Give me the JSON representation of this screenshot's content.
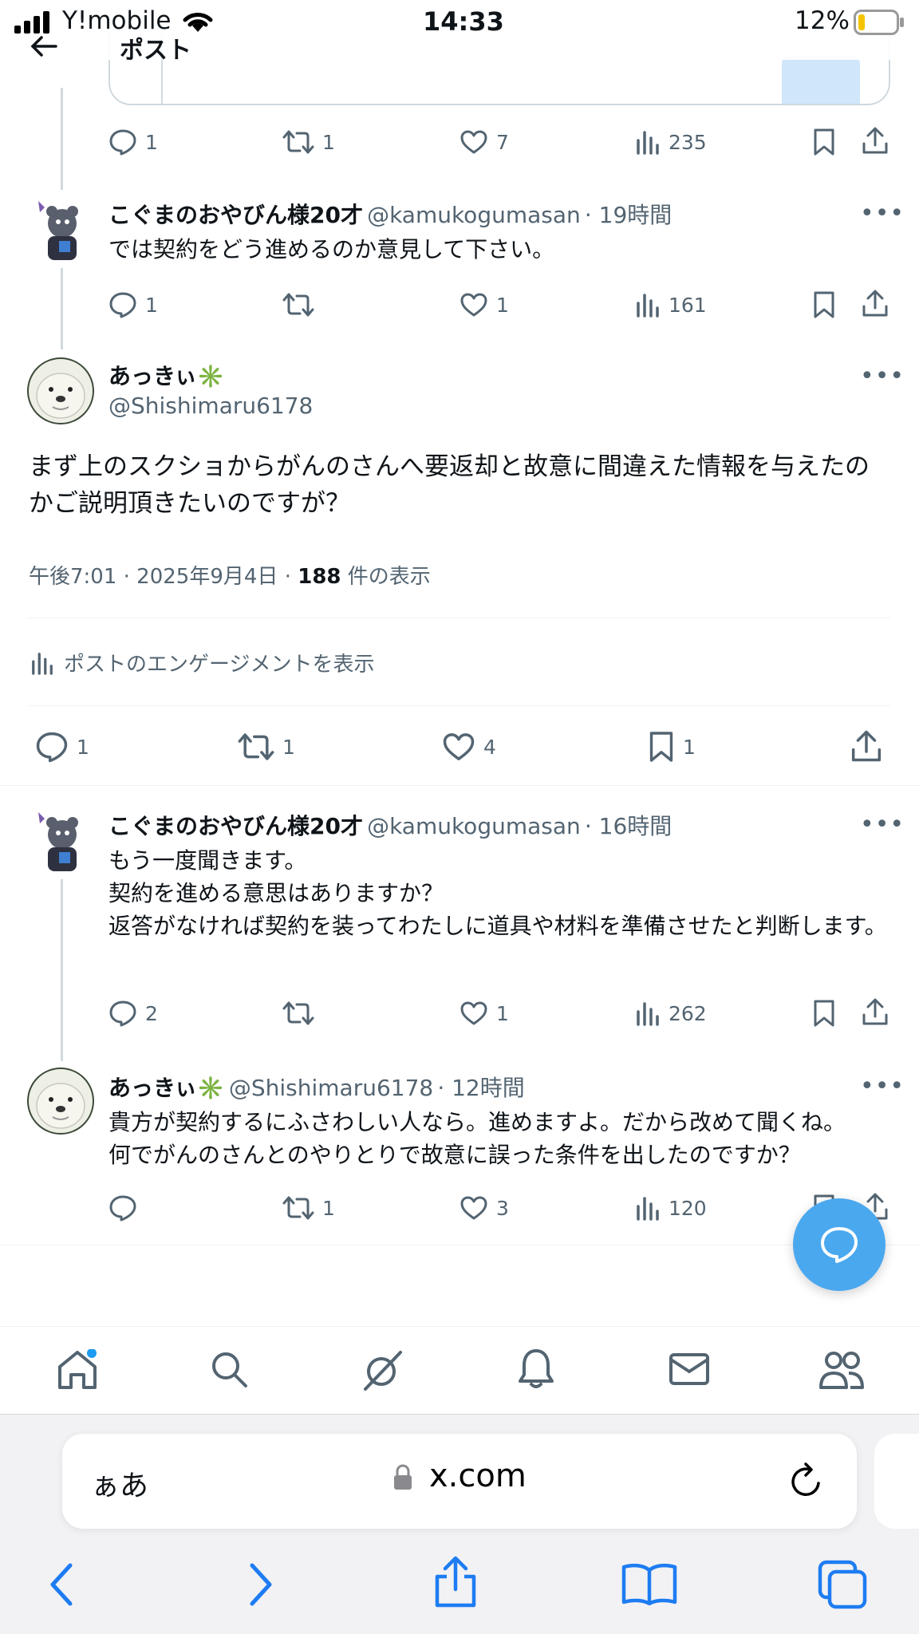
{
  "status": {
    "carrier": "Y!mobile",
    "time": "14:33",
    "battery": "12%"
  },
  "header": {
    "title": "ポスト"
  },
  "prev_post_actions": {
    "replies": "1",
    "reposts": "1",
    "likes": "7",
    "views": "235"
  },
  "reply1": {
    "name": "こぐまのおやびん様20才",
    "handle": "@kamukogumasan",
    "time": "· 19時間",
    "text": "では契約をどう進めるのか意見して下さい。",
    "replies": "1",
    "reposts": "",
    "likes": "1",
    "views": "161"
  },
  "main_post": {
    "name": "あっきぃ✳️",
    "handle": "@Shishimaru6178",
    "text": "まず上のスクショからがんのさんへ要返却と故意に間違えた情報を与えたのかご説明頂きたいのですが？",
    "date": "午後7:01 · 2025年9月4日 ·",
    "views_count": "188",
    "views_label": "件の表示",
    "engagement_label": "ポストのエンゲージメントを表示",
    "replies": "1",
    "reposts": "1",
    "likes": "4",
    "bookmarks": "1"
  },
  "reply2": {
    "name": "こぐまのおやびん様20才",
    "handle": "@kamukogumasan",
    "time": "· 16時間",
    "line1": "もう一度聞きます。",
    "line2": "契約を進める意思はありますか？",
    "line3": "返答がなければ契約を装ってわたしに道具や材料を準備させたと判断します。",
    "replies": "2",
    "reposts": "",
    "likes": "1",
    "views": "262"
  },
  "reply3": {
    "name": "あっきぃ✳️",
    "handle": "@Shishimaru6178",
    "time": "· 12時間",
    "line1": "貴方が契約するにふさわしい人なら。進めますよ。だから改めて聞くね。",
    "line2": "何でがんのさんとのやりとりで故意に誤った条件を出したのですか？",
    "replies": "",
    "reposts": "1",
    "likes": "3",
    "views": "120"
  },
  "tabbar": {
    "items": [
      "home-icon",
      "search-icon",
      "grok-icon",
      "notifications-icon",
      "messages-icon",
      "communities-icon"
    ]
  },
  "browser": {
    "aa": "ぁあ",
    "url": "x.com"
  },
  "colors": {
    "accent": "#1d9bf0",
    "fab": "#4aa8ef",
    "safari_blue": "#1e7cf2",
    "text_gray": "#536471"
  }
}
